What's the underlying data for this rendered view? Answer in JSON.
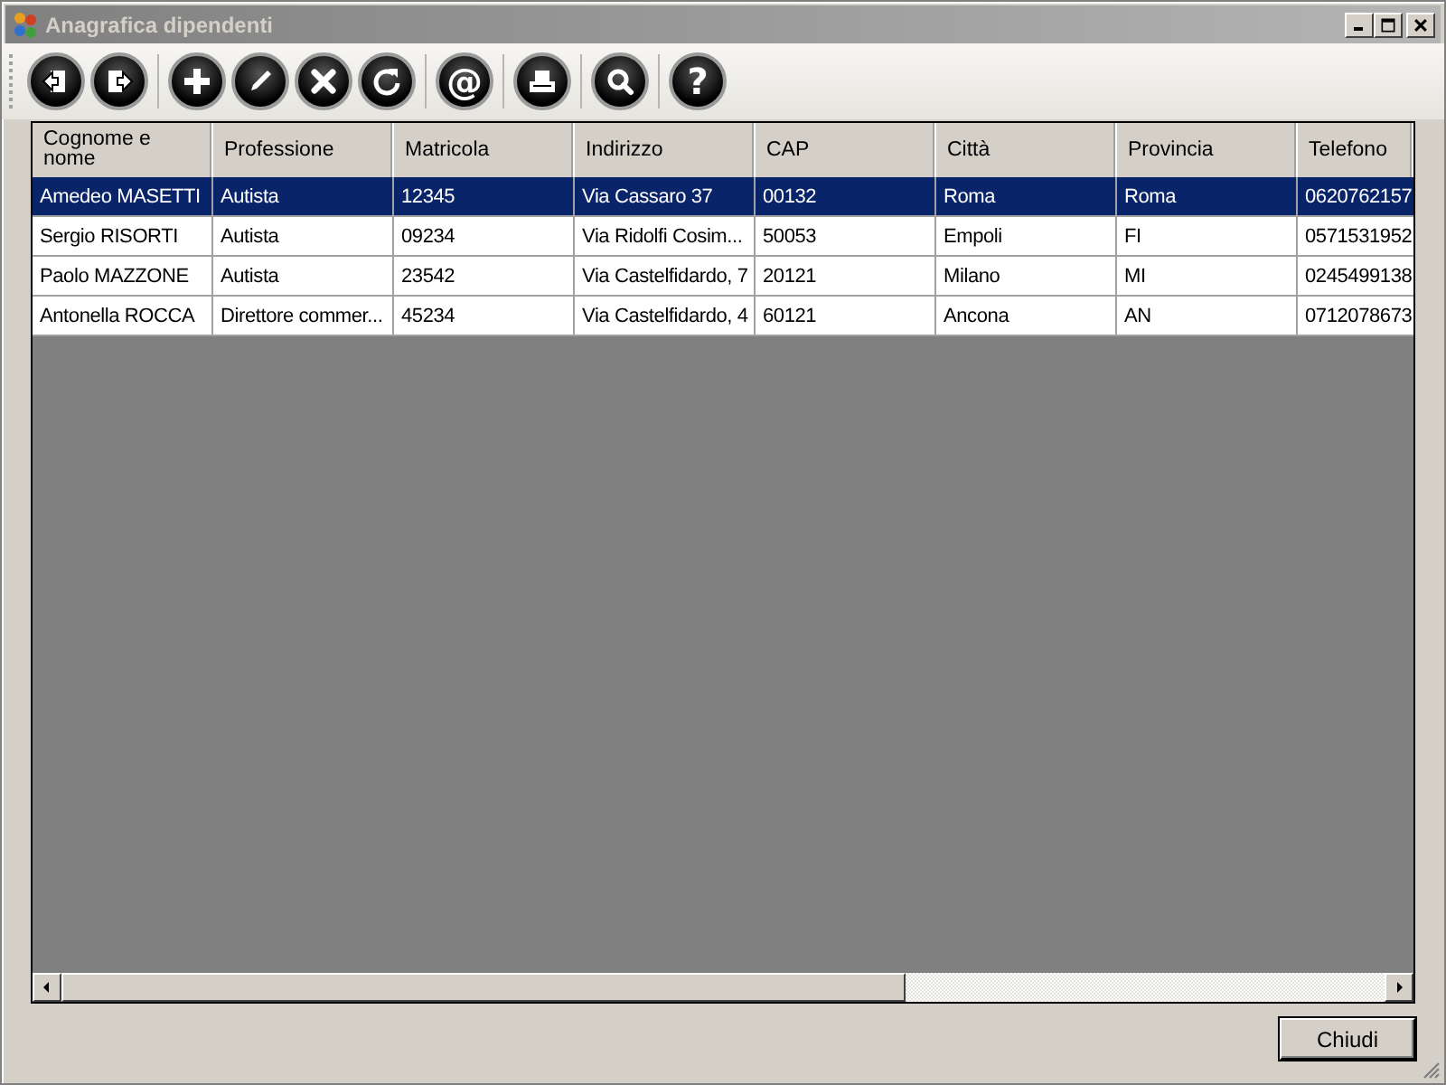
{
  "window": {
    "title": "Anagrafica dipendenti"
  },
  "toolbar": {
    "at_button": "@",
    "help_button": "?"
  },
  "table": {
    "columns": [
      "Cognome e nome",
      "Professione",
      "Matricola",
      "Indirizzo",
      "CAP",
      "Città",
      "Provincia",
      "Telefono"
    ],
    "rows": [
      {
        "selected": true,
        "cells": [
          "Amedeo MASETTI",
          "Autista",
          "12345",
          "Via Cassaro 37",
          "00132",
          "Roma",
          "Roma",
          "0620762157"
        ]
      },
      {
        "selected": false,
        "cells": [
          "Sergio RISORTI",
          "Autista",
          "09234",
          "Via Ridolfi Cosim...",
          "50053",
          "Empoli",
          "FI",
          "0571531952"
        ]
      },
      {
        "selected": false,
        "cells": [
          "Paolo MAZZONE",
          "Autista",
          "23542",
          "Via Castelfidardo, 7",
          "20121",
          "Milano",
          "MI",
          "0245499138"
        ]
      },
      {
        "selected": false,
        "cells": [
          "Antonella ROCCA",
          "Direttore commer...",
          "45234",
          "Via Castelfidardo, 4",
          "60121",
          "Ancona",
          "AN",
          "0712078673"
        ]
      }
    ]
  },
  "buttons": {
    "close": "Chiudi"
  }
}
